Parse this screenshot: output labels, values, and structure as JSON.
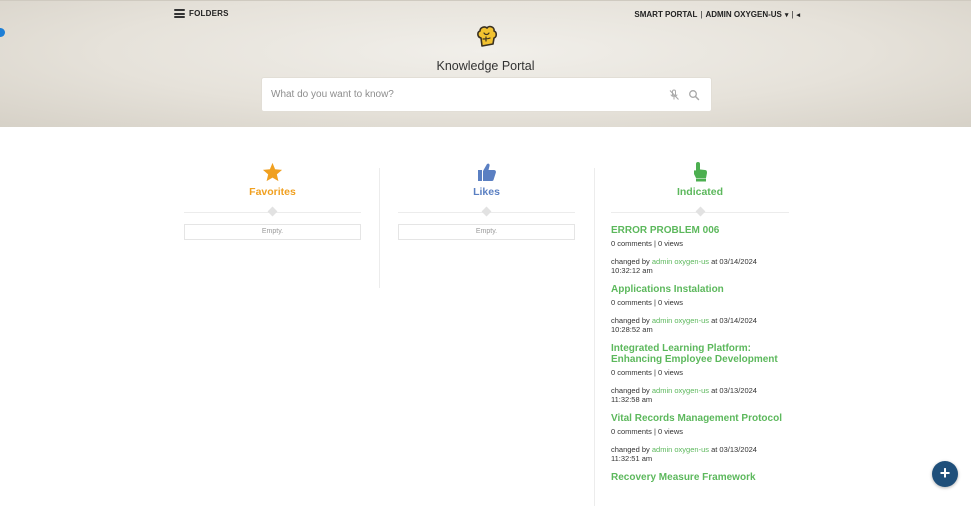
{
  "header": {
    "folders_label": "FOLDERS",
    "smart_portal": "SMART PORTAL",
    "user_name": "ADMIN OXYGEN-US",
    "separator": "|",
    "caret": "▾",
    "collapse": "◂",
    "title": "Knowledge Portal"
  },
  "search": {
    "placeholder": "What do you want to know?"
  },
  "columns": {
    "favorites": {
      "title": "Favorites",
      "empty": "Empty.",
      "color": "#f0a020"
    },
    "likes": {
      "title": "Likes",
      "empty": "Empty.",
      "color": "#5a7fc2"
    },
    "indicated": {
      "title": "Indicated",
      "color": "#5cb85c"
    }
  },
  "indicated_items": [
    {
      "title": "ERROR PROBLEM 006",
      "comments": "0 comments",
      "views": "0 views",
      "changed_prefix": "changed by ",
      "user": "admin oxygen-us",
      "at": " at 03/14/2024",
      "time": "10:32:12 am"
    },
    {
      "title": "Applications Instalation",
      "comments": "0 comments",
      "views": "0 views",
      "changed_prefix": "changed by ",
      "user": "admin oxygen-us",
      "at": " at 03/14/2024",
      "time": "10:28:52 am"
    },
    {
      "title": "Integrated Learning Platform: Enhancing Employee Development",
      "comments": "0 comments",
      "views": "0 views",
      "changed_prefix": "changed by ",
      "user": "admin oxygen-us",
      "at": " at 03/13/2024",
      "time": "11:32:58 am"
    },
    {
      "title": "Vital Records Management Protocol",
      "comments": "0 comments",
      "views": "0 views",
      "changed_prefix": "changed by ",
      "user": "admin oxygen-us",
      "at": " at 03/13/2024",
      "time": "11:32:51 am"
    },
    {
      "title": "Recovery Measure Framework",
      "comments": "",
      "views": "",
      "changed_prefix": "",
      "user": "",
      "at": "",
      "time": ""
    }
  ],
  "fab": {
    "label": "+"
  }
}
